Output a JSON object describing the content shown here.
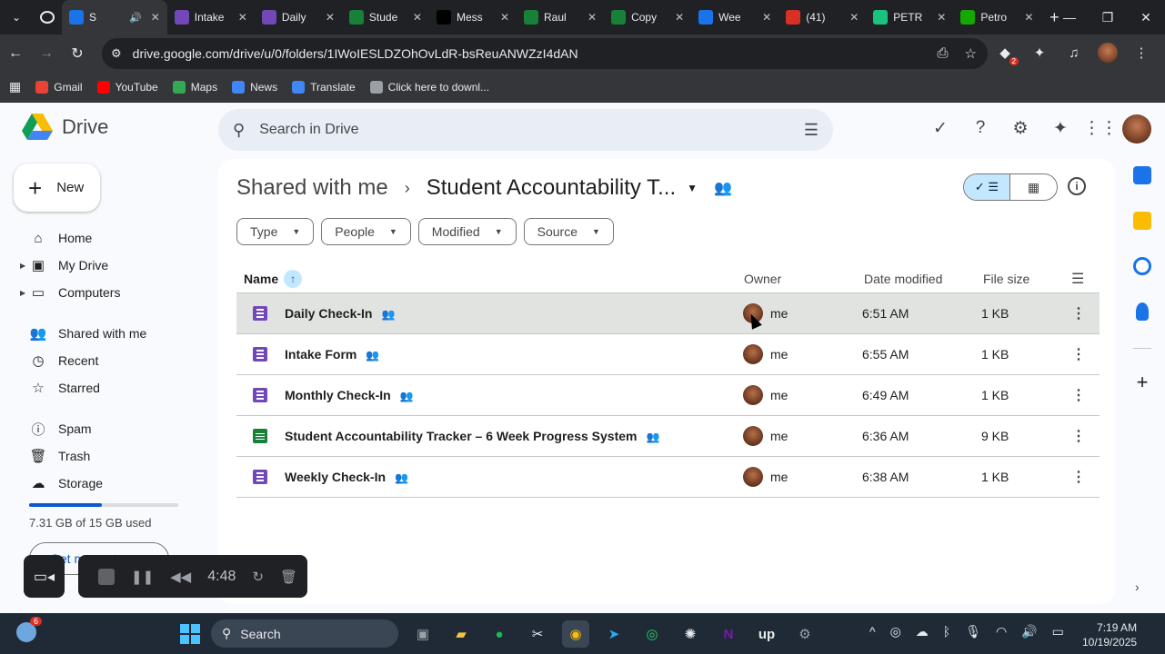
{
  "browser": {
    "tabs": [
      {
        "title": "S",
        "favicon": "drive-icon",
        "color": "#1a73e8",
        "active": true
      },
      {
        "title": "Intake",
        "favicon": "forms-icon",
        "color": "#7248b9"
      },
      {
        "title": "Daily",
        "favicon": "forms-icon",
        "color": "#7248b9"
      },
      {
        "title": "Stude",
        "favicon": "sheets-icon",
        "color": "#188038"
      },
      {
        "title": "Mess",
        "favicon": "upwork-icon",
        "color": "#000000"
      },
      {
        "title": "Raul",
        "favicon": "sheets-icon",
        "color": "#188038"
      },
      {
        "title": "Copy",
        "favicon": "sheets-icon",
        "color": "#188038"
      },
      {
        "title": "Wee",
        "favicon": "settings-icon",
        "color": "#1a73e8"
      },
      {
        "title": "(41)",
        "favicon": "badge-icon",
        "color": "#d93025"
      },
      {
        "title": "PETR",
        "favicon": "gpt-icon",
        "color": "#19c37d"
      },
      {
        "title": "Petro",
        "favicon": "upwork-icon",
        "color": "#14a800"
      }
    ],
    "url": "drive.google.com/drive/u/0/folders/1IWoIESLDZOhOvLdR-bsReuANWZzI4dAN",
    "extension_badge": "2",
    "bookmarks": [
      {
        "label": "Gmail",
        "color": "#ea4335"
      },
      {
        "label": "YouTube",
        "color": "#ff0000"
      },
      {
        "label": "Maps",
        "color": "#34a853"
      },
      {
        "label": "News",
        "color": "#4285f4"
      },
      {
        "label": "Translate",
        "color": "#4285f4"
      },
      {
        "label": "Click here to downl...",
        "color": "#9aa0a6"
      }
    ]
  },
  "drive": {
    "brand": "Drive",
    "search_placeholder": "Search in Drive",
    "new_label": "New",
    "nav": {
      "home": "Home",
      "my_drive": "My Drive",
      "computers": "Computers",
      "shared": "Shared with me",
      "recent": "Recent",
      "starred": "Starred",
      "spam": "Spam",
      "trash": "Trash",
      "storage": "Storage"
    },
    "storage_used_fraction": 0.487,
    "storage_text": "7.31 GB of 15 GB used",
    "get_more": "Get more storage",
    "breadcrumb": {
      "parent": "Shared with me",
      "current": "Student Accountability T..."
    },
    "filters": [
      "Type",
      "People",
      "Modified",
      "Source"
    ],
    "columns": {
      "name": "Name",
      "owner": "Owner",
      "date": "Date modified",
      "size": "File size"
    },
    "files": [
      {
        "name": "Daily Check-In",
        "type": "forms",
        "owner": "me",
        "date": "6:51 AM",
        "size": "1 KB"
      },
      {
        "name": "Intake Form",
        "type": "forms",
        "owner": "me",
        "date": "6:55 AM",
        "size": "1 KB"
      },
      {
        "name": "Monthly Check-In",
        "type": "forms",
        "owner": "me",
        "date": "6:49 AM",
        "size": "1 KB"
      },
      {
        "name": "Student Accountability Tracker – 6 Week Progress System",
        "type": "sheets",
        "owner": "me",
        "date": "6:36 AM",
        "size": "9 KB"
      },
      {
        "name": "Weekly Check-In",
        "type": "forms",
        "owner": "me",
        "date": "6:38 AM",
        "size": "1 KB"
      }
    ]
  },
  "recorder": {
    "time": "4:48"
  },
  "taskbar": {
    "weather_badge": "6",
    "search": "Search",
    "time": "7:19 AM",
    "date": "10/19/2025"
  }
}
